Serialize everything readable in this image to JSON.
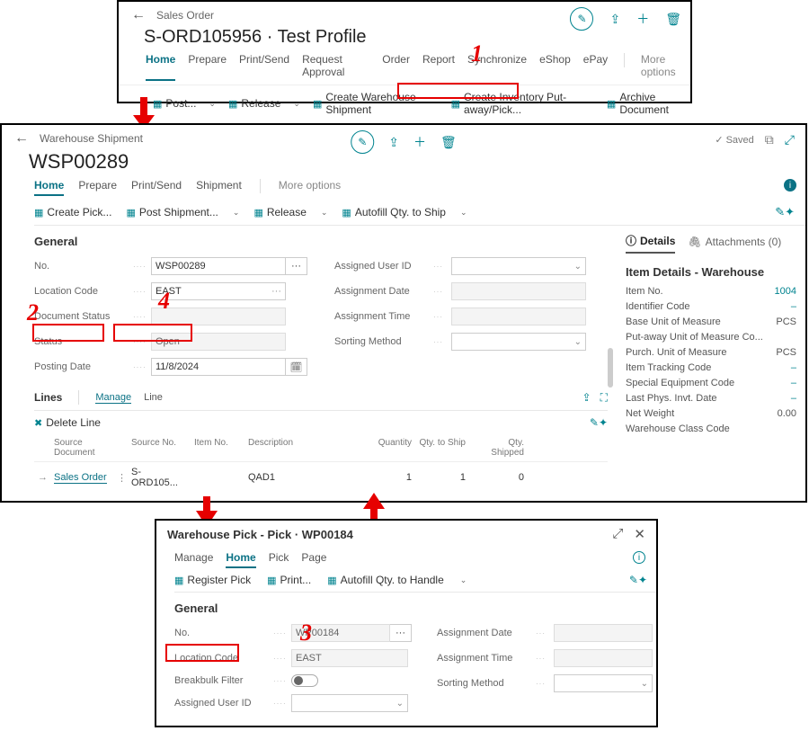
{
  "salesOrder": {
    "crumb": "Sales Order",
    "title": "S-ORD105956 · Test Profile",
    "tabs": [
      "Home",
      "Prepare",
      "Print/Send",
      "Request Approval",
      "Order",
      "Report",
      "Synchronize",
      "eShop",
      "ePay"
    ],
    "more": "More options",
    "actions": {
      "post": "Post...",
      "release": "Release",
      "createWhse": "Create Warehouse Shipment",
      "createInv": "Create Inventory Put-away/Pick...",
      "archive": "Archive Document"
    }
  },
  "shipment": {
    "crumb": "Warehouse Shipment",
    "docNo": "WSP00289",
    "saved": "Saved",
    "tabs": [
      "Home",
      "Prepare",
      "Print/Send",
      "Shipment"
    ],
    "more": "More options",
    "actions": {
      "createPick": "Create Pick...",
      "postShipment": "Post Shipment...",
      "release": "Release",
      "autofill": "Autofill Qty. to Ship"
    },
    "general": "General",
    "fields": {
      "no": "No.",
      "noVal": "WSP00289",
      "loc": "Location Code",
      "locVal": "EAST",
      "docStat": "Document Status",
      "docStatVal": "",
      "status": "Status",
      "statusVal": "Open",
      "posting": "Posting Date",
      "postingVal": "11/8/2024",
      "assignedUser": "Assigned User ID",
      "assignedUserVal": "",
      "assignDate": "Assignment Date",
      "assignDateVal": "",
      "assignTime": "Assignment Time",
      "assignTimeVal": "",
      "sortMethod": "Sorting Method",
      "sortMethodVal": ""
    },
    "lines": {
      "header": "Lines",
      "manage": "Manage",
      "line": "Line",
      "deleteLine": "Delete Line",
      "cols": {
        "srcDoc": "Source Document",
        "srcNo": "Source No.",
        "item": "Item No.",
        "desc": "Description",
        "qty": "Quantity",
        "qtyShip": "Qty. to Ship",
        "qtyShipped": "Qty. Shipped"
      },
      "row": {
        "srcDoc": "Sales Order",
        "srcNo": "S-ORD105...",
        "item": "",
        "desc": "QAD1",
        "qty": "1",
        "qtyShip": "1",
        "qtyShipped": "0"
      }
    },
    "factbox": {
      "details": "Details",
      "attachments": "Attachments (0)",
      "title": "Item Details - Warehouse",
      "rows": {
        "itemNo": "Item No.",
        "itemNoVal": "1004",
        "idCode": "Identifier Code",
        "idCodeVal": "–",
        "baseUom": "Base Unit of Measure",
        "baseUomVal": "PCS",
        "putUom": "Put-away Unit of Measure Co...",
        "putUomVal": "",
        "purchUom": "Purch. Unit of Measure",
        "purchUomVal": "PCS",
        "track": "Item Tracking Code",
        "trackVal": "–",
        "special": "Special Equipment Code",
        "specialVal": "–",
        "lastInv": "Last Phys. Invt. Date",
        "lastInvVal": "–",
        "netWeight": "Net Weight",
        "netWeightVal": "0.00",
        "whseClass": "Warehouse Class Code",
        "whseClassVal": ""
      }
    }
  },
  "pick": {
    "title": "Warehouse Pick - Pick · WP00184",
    "tabs": [
      "Manage",
      "Home",
      "Pick",
      "Page"
    ],
    "actions": {
      "register": "Register Pick",
      "print": "Print...",
      "autofill": "Autofill Qty. to Handle"
    },
    "general": "General",
    "fields": {
      "no": "No.",
      "noVal": "WP00184",
      "loc": "Location Code",
      "locVal": "EAST",
      "break": "Breakbulk Filter",
      "assigned": "Assigned User ID",
      "assignedVal": "",
      "assignDate": "Assignment Date",
      "assignDateVal": "",
      "assignTime": "Assignment Time",
      "assignTimeVal": "",
      "sortMethod": "Sorting Method",
      "sortMethodVal": ""
    }
  },
  "steps": {
    "s1": "1",
    "s2": "2",
    "s3": "3",
    "s4": "4"
  }
}
